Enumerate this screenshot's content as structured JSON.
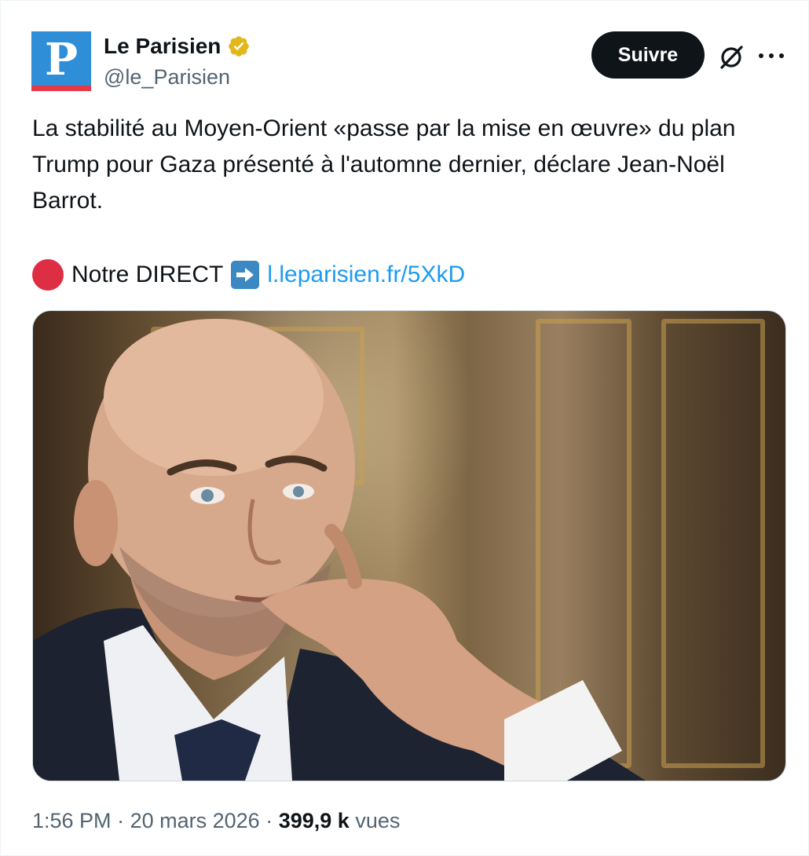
{
  "author": {
    "avatar_letter": "P",
    "display_name": "Le Parisien",
    "handle": "@le_Parisien",
    "verified": true
  },
  "actions": {
    "follow_label": "Suivre",
    "grok_icon": "grok-icon",
    "more_icon": "more-icon"
  },
  "tweet": {
    "text": "La stabilité au Moyen-Orient «passe par la mise en œuvre» du plan Trump pour Gaza présenté à l'automne dernier, déclare Jean-Noël Barrot.",
    "direct_label": "Notre DIRECT",
    "direct_emoji": "red-circle-icon",
    "arrow_emoji": "right-arrow-icon",
    "link_text": "l.leparisien.fr/5XkD"
  },
  "footer": {
    "time": "1:56 PM",
    "separator": "·",
    "date": "20 mars 2026",
    "views_count": "399,9 k",
    "views_label": "vues"
  },
  "colors": {
    "follow_bg": "#0f1419",
    "link": "#1d9bf0",
    "secondary_text": "#536471",
    "avatar_bg": "#2e8fd8",
    "verified_badge": "#e2b719"
  }
}
